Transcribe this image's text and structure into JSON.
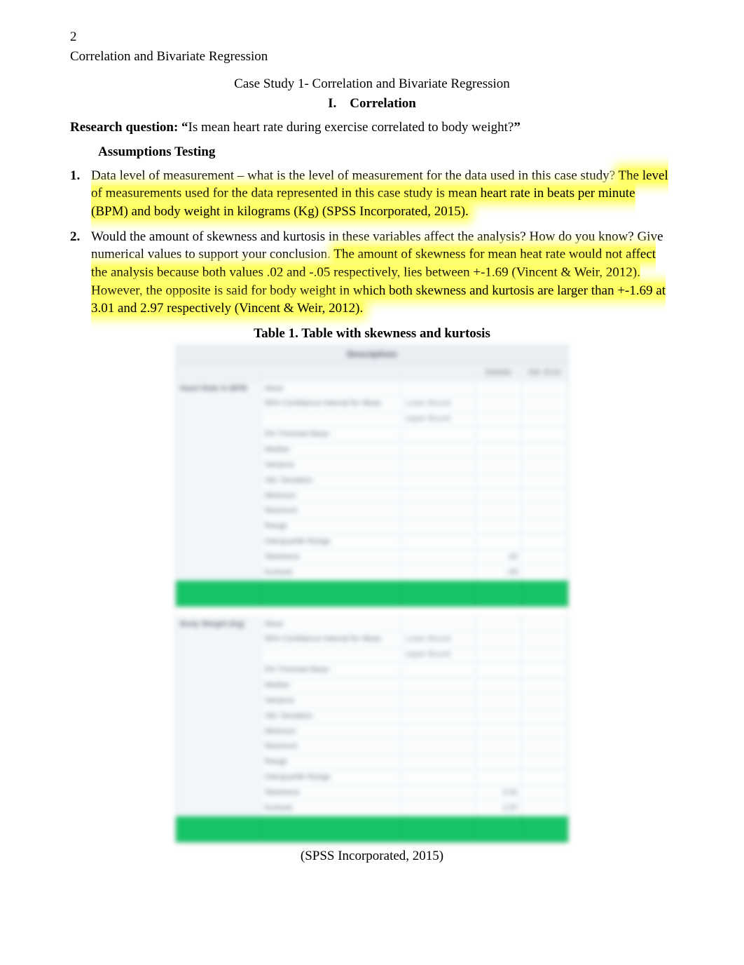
{
  "page_number": "2",
  "running_head": "Correlation and Bivariate Regression",
  "title": "Case Study 1- Correlation and Bivariate Regression",
  "section": {
    "numeral": "I.",
    "label": "Correlation"
  },
  "research_question": {
    "label": "Research question: “",
    "text": "Is mean heart rate during exercise correlated to body weight?",
    "close": "”"
  },
  "assumptions_heading": "Assumptions Testing",
  "items": [
    {
      "num": "1.",
      "lead": "Data level of measurement – what is the level of measurement for the data used in this case study? ",
      "highlight": "The level of measurements used for the data represented in this case study is mean heart rate in beats per minute (BPM) and body weight in kilograms (Kg) (SPSS Incorporated, 2015)."
    },
    {
      "num": "2.",
      "lead": "Would the amount of skewness and kurtosis in these variables affect the analysis? How do you know? Give numerical values to support your conclusion. ",
      "highlight": "The amount of skewness for mean heat rate would not affect the analysis because both values .02 and -.05 respectively, lies between +-1.69 (Vincent & Weir, 2012). However, the opposite is said for body weight in which both skewness and kurtosis are larger than +-1.69 at 3.01 and 2.97 respectively (Vincent & Weir, 2012)."
    }
  ],
  "table_caption": "Table 1. Table with skewness and kurtosis",
  "source_line": "(SPSS Incorporated, 2015)",
  "chart_data": {
    "type": "table",
    "title": "Descriptives",
    "columns": [
      "Statistic",
      "Std. Error"
    ],
    "variables": [
      {
        "name": "Heart Rate in BPM",
        "rows": [
          {
            "label": "Mean",
            "sub": "",
            "stat": "",
            "se": ""
          },
          {
            "label": "95% Confidence Interval for Mean",
            "sub": "Lower Bound",
            "stat": "",
            "se": ""
          },
          {
            "label": "",
            "sub": "Upper Bound",
            "stat": "",
            "se": ""
          },
          {
            "label": "5% Trimmed Mean",
            "sub": "",
            "stat": "",
            "se": ""
          },
          {
            "label": "Median",
            "sub": "",
            "stat": "",
            "se": ""
          },
          {
            "label": "Variance",
            "sub": "",
            "stat": "",
            "se": ""
          },
          {
            "label": "Std. Deviation",
            "sub": "",
            "stat": "",
            "se": ""
          },
          {
            "label": "Minimum",
            "sub": "",
            "stat": "",
            "se": ""
          },
          {
            "label": "Maximum",
            "sub": "",
            "stat": "",
            "se": ""
          },
          {
            "label": "Range",
            "sub": "",
            "stat": "",
            "se": ""
          },
          {
            "label": "Interquartile Range",
            "sub": "",
            "stat": "",
            "se": ""
          },
          {
            "label": "Skewness",
            "sub": "",
            "stat": ".02",
            "se": ""
          },
          {
            "label": "Kurtosis",
            "sub": "",
            "stat": "-.05",
            "se": ""
          }
        ]
      },
      {
        "name": "Body Weight (Kg)",
        "rows": [
          {
            "label": "Mean",
            "sub": "",
            "stat": "",
            "se": ""
          },
          {
            "label": "95% Confidence Interval for Mean",
            "sub": "Lower Bound",
            "stat": "",
            "se": ""
          },
          {
            "label": "",
            "sub": "Upper Bound",
            "stat": "",
            "se": ""
          },
          {
            "label": "5% Trimmed Mean",
            "sub": "",
            "stat": "",
            "se": ""
          },
          {
            "label": "Median",
            "sub": "",
            "stat": "",
            "se": ""
          },
          {
            "label": "Variance",
            "sub": "",
            "stat": "",
            "se": ""
          },
          {
            "label": "Std. Deviation",
            "sub": "",
            "stat": "",
            "se": ""
          },
          {
            "label": "Minimum",
            "sub": "",
            "stat": "",
            "se": ""
          },
          {
            "label": "Maximum",
            "sub": "",
            "stat": "",
            "se": ""
          },
          {
            "label": "Range",
            "sub": "",
            "stat": "",
            "se": ""
          },
          {
            "label": "Interquartile Range",
            "sub": "",
            "stat": "",
            "se": ""
          },
          {
            "label": "Skewness",
            "sub": "",
            "stat": "3.01",
            "se": ""
          },
          {
            "label": "Kurtosis",
            "sub": "",
            "stat": "2.97",
            "se": ""
          }
        ]
      }
    ]
  }
}
